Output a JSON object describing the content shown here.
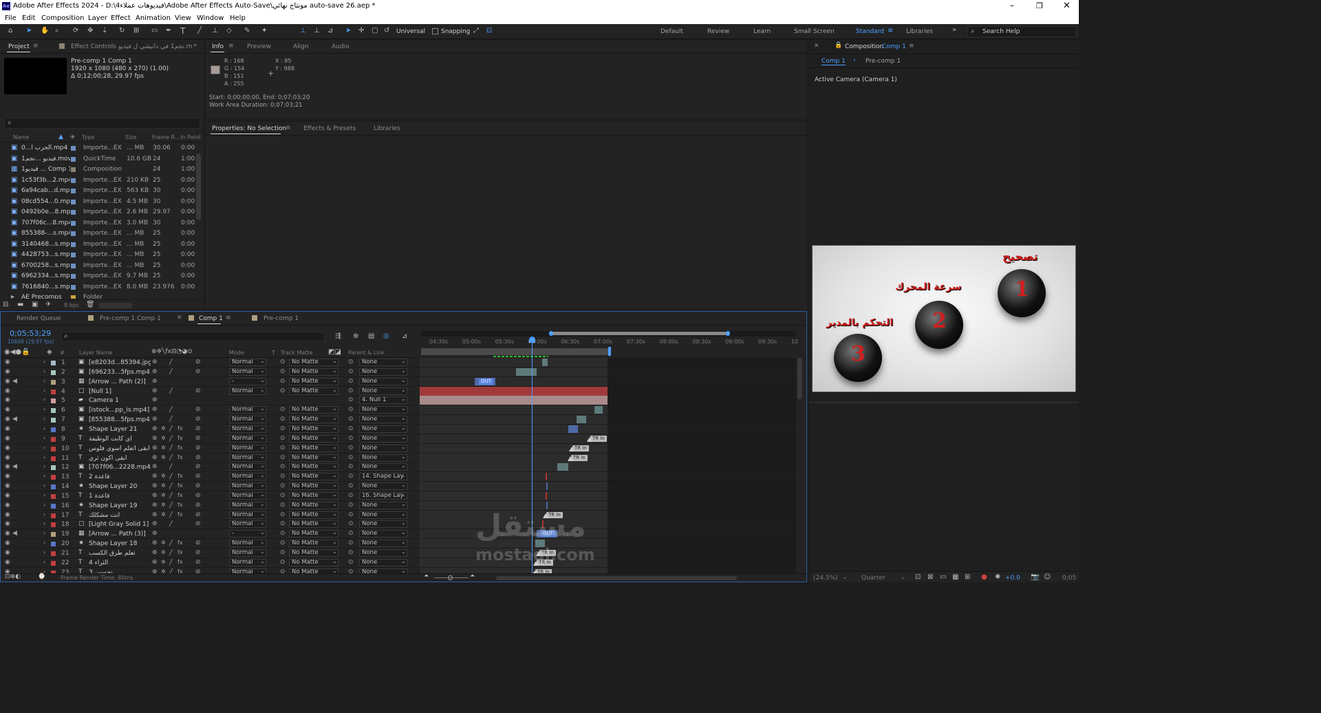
{
  "window": {
    "title": "Adobe After Effects 2024 - D:\\فيديوهات عملاء4\\Adobe After Effects Auto-Save\\مونتاج نهائي auto-save 26.aep *",
    "app_icon": "Ae"
  },
  "menu": [
    "File",
    "Edit",
    "Composition",
    "Layer",
    "Effect",
    "Animation",
    "View",
    "Window",
    "Help"
  ],
  "toolbar": {
    "universal": "Universal",
    "snapping": "Snapping",
    "workspaces": [
      "Default",
      "Review",
      "Learn",
      "Small Screen",
      "Standard",
      "Libraries"
    ],
    "active_workspace": "Standard",
    "search_placeholder": "Search Help"
  },
  "project": {
    "tab": "Project",
    "effect_tab": "Effect Controls نجم1 في دانيشي ل فيديو.m",
    "preview": {
      "name": "Pre-comp 1 Comp 1",
      "dims": "1920 x 1080  (480 x 270) (1.00)",
      "duration": "Δ 0;12;00;28, 29.97 fps"
    },
    "columns": [
      "Name",
      "Type",
      "Size",
      "Frame R...",
      "In Point"
    ],
    "rows": [
      {
        "name": "الحرب أ...0.mp4",
        "type": "Importe...EX",
        "size": "... MB",
        "fps": "30.06",
        "in": "0:00",
        "color": "#6e8fc2",
        "icon": "footage"
      },
      {
        "name": "فيديو ...نجم1.mov",
        "type": "QuickTime",
        "size": "10.6 GB",
        "fps": "24",
        "in": "1:00",
        "color": "#6e8fc2",
        "icon": "footage"
      },
      {
        "name": "فيديو1 ... Comp 1",
        "type": "Composition",
        "size": "",
        "fps": "24",
        "in": "1:00",
        "color": "#8a8470",
        "icon": "comp"
      },
      {
        "name": "1c53f3b...2.mp4",
        "type": "Importe...EX",
        "size": "210 KB",
        "fps": "25",
        "in": "0:00",
        "color": "#6e8fc2",
        "icon": "footage"
      },
      {
        "name": "6a94cab...d.mp4",
        "type": "Importe...EX",
        "size": "563 KB",
        "fps": "30",
        "in": "0:00",
        "color": "#6e8fc2",
        "icon": "footage"
      },
      {
        "name": "08cd554...0.mp4",
        "type": "Importe...EX",
        "size": "4.5 MB",
        "fps": "30",
        "in": "0:00",
        "color": "#6e8fc2",
        "icon": "footage"
      },
      {
        "name": "0492b0e...8.mp4",
        "type": "Importe...EX",
        "size": "2.6 MB",
        "fps": "29.97",
        "in": "0:00",
        "color": "#6e8fc2",
        "icon": "footage"
      },
      {
        "name": "707f06c...8.mp4",
        "type": "Importe...EX",
        "size": "3.0 MB",
        "fps": "30",
        "in": "0:00",
        "color": "#6e8fc2",
        "icon": "footage"
      },
      {
        "name": "855388-...s.mp4",
        "type": "Importe...EX",
        "size": "... MB",
        "fps": "25",
        "in": "0:00",
        "color": "#6e8fc2",
        "icon": "footage"
      },
      {
        "name": "3140468...s.mp4",
        "type": "Importe...EX",
        "size": "... MB",
        "fps": "25",
        "in": "0:00",
        "color": "#6e8fc2",
        "icon": "footage"
      },
      {
        "name": "4428753...s.mp4",
        "type": "Importe...EX",
        "size": "... MB",
        "fps": "25",
        "in": "0:00",
        "color": "#6e8fc2",
        "icon": "footage"
      },
      {
        "name": "6700258...s.mp4",
        "type": "Importe...EX",
        "size": "... MB",
        "fps": "25",
        "in": "0:00",
        "color": "#6e8fc2",
        "icon": "footage"
      },
      {
        "name": "6962334...s.mp4",
        "type": "Importe...EX",
        "size": "9.7 MB",
        "fps": "25",
        "in": "0:00",
        "color": "#6e8fc2",
        "icon": "footage"
      },
      {
        "name": "7616840...s.mp4",
        "type": "Importe...EX",
        "size": "8.0 MB",
        "fps": "23.976",
        "in": "0:00",
        "color": "#6e8fc2",
        "icon": "footage"
      },
      {
        "name": "AE Precomps",
        "type": "Folder",
        "size": "",
        "fps": "",
        "in": "",
        "color": "#c9a640",
        "icon": "folder"
      }
    ],
    "bpc": "8 bpc"
  },
  "info": {
    "tabs": [
      "Info",
      "Preview",
      "Align",
      "Audio"
    ],
    "r": "R : 168",
    "g": "G : 154",
    "b": "B : 151",
    "a": "A : 255",
    "x": "X : 85",
    "y": "Y : 988",
    "start": "Start: 0;00;00;00, End: 0;07;03;20",
    "work": "Work Area Duration: 0;07;03;21",
    "swatch": "#a89a97"
  },
  "props": {
    "tabs": [
      "Properties: No Selection",
      "Effects & Presets",
      "Libraries"
    ]
  },
  "comp_viewer": {
    "tab": "Composition",
    "tab_accent": "Comp 1",
    "crumbs": [
      "Comp 1",
      "Pre-comp 1"
    ],
    "camera": "Active Camera (Camera 1)",
    "buttons": [
      {
        "num": "1",
        "label": "تصحيح"
      },
      {
        "num": "2",
        "label": "سرعة المحرك"
      },
      {
        "num": "3",
        "label": "التحكم بالمدير"
      }
    ],
    "zoom": "(24.5%)",
    "quality": "Quarter",
    "exposure": "+0.0",
    "time_right": "0;05"
  },
  "timeline": {
    "tabs": [
      "Render Queue",
      "Pre-comp 1 Comp 1",
      "Comp 1",
      "Pre-comp 1"
    ],
    "active_tab": "Comp 1",
    "timecode": "0;05;53;29",
    "frames": "10609 (29.97 fps)",
    "ruler": [
      "04:30s",
      "05:00s",
      "05:30s",
      "06:00s",
      "06:30s",
      "07:00s",
      "07:30s",
      "08:00s",
      "08:30s",
      "09:00s",
      "09:30s",
      "10"
    ],
    "columns": [
      "#",
      "Layer Name",
      "Mode",
      "T",
      "Track Matte",
      "Parent & Link"
    ],
    "layers": [
      {
        "n": "1",
        "name": "[e8203d...85394.jpg]",
        "mode": "Normal",
        "matte": "No Matte",
        "parent": "None",
        "color": "#a8b8c8",
        "kind": "img"
      },
      {
        "n": "2",
        "name": "[696233...5fps.mp4]",
        "mode": "Normal",
        "matte": "No Matte",
        "parent": "None",
        "color": "#a8c8c0",
        "kind": "img"
      },
      {
        "n": "3",
        "name": "[Arrow ... Path (2)]",
        "mode": "-",
        "matte": "No Matte",
        "parent": "None",
        "color": "#b0a080",
        "kind": "comp"
      },
      {
        "n": "4",
        "name": "[Null 1]",
        "mode": "Normal",
        "matte": "No Matte",
        "parent": "None",
        "color": "#c04040",
        "kind": "null"
      },
      {
        "n": "5",
        "name": "Camera 1",
        "mode": "",
        "matte": "",
        "parent": "4. Null 1",
        "color": "#d0a0a0",
        "kind": "cam"
      },
      {
        "n": "6",
        "name": "[istock...pp_is.mp4]",
        "mode": "Normal",
        "matte": "No Matte",
        "parent": "None",
        "color": "#a8c8c0",
        "kind": "img"
      },
      {
        "n": "7",
        "name": "[855388...5fps.mp4]",
        "mode": "Normal",
        "matte": "No Matte",
        "parent": "None",
        "color": "#a8c8c0",
        "kind": "img"
      },
      {
        "n": "8",
        "name": "Shape Layer 21",
        "mode": "Normal",
        "matte": "No Matte",
        "parent": "None",
        "color": "#5a78c8",
        "kind": "shape"
      },
      {
        "n": "9",
        "name": "اي كانت الوظيفة",
        "mode": "Normal",
        "matte": "No Matte",
        "parent": "None",
        "color": "#c04040",
        "kind": "text"
      },
      {
        "n": "10",
        "name": "ابقى اتعلم اسوي فلوس",
        "mode": "Normal",
        "matte": "No Matte",
        "parent": "None",
        "color": "#c04040",
        "kind": "text"
      },
      {
        "n": "11",
        "name": "ابقى اكون ثري",
        "mode": "Normal",
        "matte": "No Matte",
        "parent": "None",
        "color": "#c04040",
        "kind": "text"
      },
      {
        "n": "12",
        "name": "[707f06...2228.mp4]",
        "mode": "Normal",
        "matte": "No Matte",
        "parent": "None",
        "color": "#a8c8c0",
        "kind": "img"
      },
      {
        "n": "13",
        "name": "قاعدة 2",
        "mode": "Normal",
        "matte": "No Matte",
        "parent": "14. Shape Lay",
        "color": "#c04040",
        "kind": "text"
      },
      {
        "n": "14",
        "name": "Shape Layer 20",
        "mode": "Normal",
        "matte": "No Matte",
        "parent": "None",
        "color": "#5a78c8",
        "kind": "shape"
      },
      {
        "n": "15",
        "name": "قاعدة 1",
        "mode": "Normal",
        "matte": "No Matte",
        "parent": "16. Shape Lay",
        "color": "#c04040",
        "kind": "text"
      },
      {
        "n": "16",
        "name": "Shape Layer 19",
        "mode": "Normal",
        "matte": "No Matte",
        "parent": "None",
        "color": "#5a78c8",
        "kind": "shape"
      },
      {
        "n": "17",
        "name": "انت مشكلك",
        "mode": "Normal",
        "matte": "No Matte",
        "parent": "None",
        "color": "#c04040",
        "kind": "text"
      },
      {
        "n": "18",
        "name": "[Light Gray Solid 1]",
        "mode": "Normal",
        "matte": "No Matte",
        "parent": "None",
        "color": "#c04040",
        "kind": "solid"
      },
      {
        "n": "19",
        "name": "[Arrow ... Path (3)]",
        "mode": "-",
        "matte": "No Matte",
        "parent": "None",
        "color": "#b0a080",
        "kind": "comp"
      },
      {
        "n": "20",
        "name": "Shape Layer 18",
        "mode": "Normal",
        "matte": "No Matte",
        "parent": "None",
        "color": "#5a78c8",
        "kind": "shape"
      },
      {
        "n": "21",
        "name": "تعلم طرق الكسب",
        "mode": "Normal",
        "matte": "No Matte",
        "parent": "None",
        "color": "#c04040",
        "kind": "text"
      },
      {
        "n": "22",
        "name": "الثراء 4",
        "mode": "Normal",
        "matte": "No Matte",
        "parent": "None",
        "color": "#c04040",
        "kind": "text"
      },
      {
        "n": "23",
        "name": "تحسين 3 ...",
        "mode": "Normal",
        "matte": "No Matte",
        "parent": "None",
        "color": "#c04040",
        "kind": "text"
      }
    ],
    "clip_labels": {
      "out": "OUT",
      "tr": "TR In"
    },
    "render_time": "Frame Render Time:  80ms"
  },
  "watermark": {
    "arabic": "مستقل",
    "latin": "mostaql.com"
  }
}
